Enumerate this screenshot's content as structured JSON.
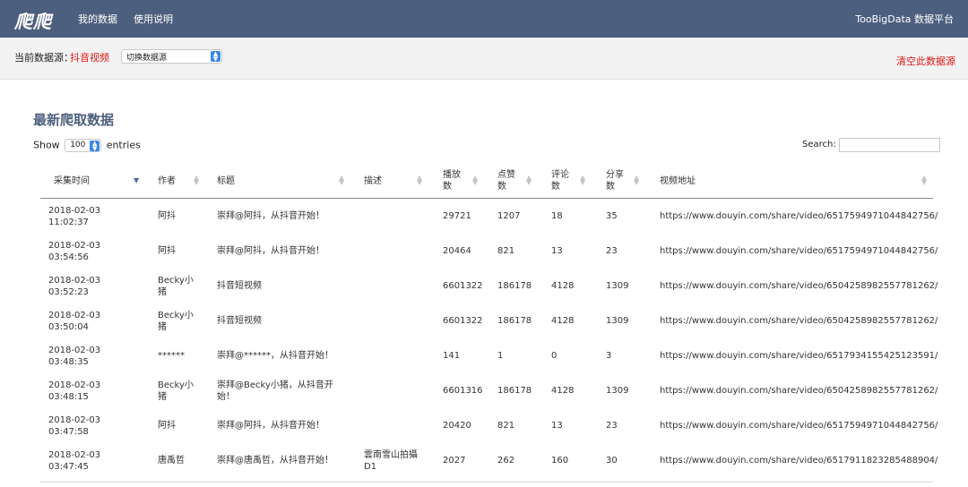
{
  "nav": {
    "logo": "爬爬",
    "links": [
      "我的数据",
      "使用说明"
    ],
    "brand": "TooBigData 数据平台"
  },
  "source": {
    "label": "当前数据源：",
    "value": "抖音视频",
    "select_label": "切换数据源",
    "clear_label": "清空此数据源"
  },
  "section_title": "最新爬取数据",
  "controls": {
    "show": "Show",
    "length": "100",
    "entries": "entries",
    "search": "Search:"
  },
  "table": {
    "headers": [
      "采集时间",
      "作者",
      "标题",
      "描述",
      "播放\n数",
      "点赞\n数",
      "评论\n数",
      "分享\n数",
      "视频地址"
    ],
    "rows": [
      [
        "2018-02-03\n11:02:37",
        "阿抖",
        "崇拜@阿抖，从抖音开始！",
        "",
        "29721",
        "1207",
        "18",
        "35",
        "https://www.douyin.com/share/video/6517594971044842756/"
      ],
      [
        "2018-02-03\n03:54:56",
        "阿抖",
        "崇拜@阿抖，从抖音开始！",
        "",
        "20464",
        "821",
        "13",
        "23",
        "https://www.douyin.com/share/video/6517594971044842756/"
      ],
      [
        "2018-02-03\n03:52:23",
        "Becky小\n猪",
        "抖音短视频",
        "",
        "6601322",
        "186178",
        "4128",
        "1309",
        "https://www.douyin.com/share/video/6504258982557781262/"
      ],
      [
        "2018-02-03\n03:50:04",
        "Becky小\n猪",
        "抖音短视频",
        "",
        "6601322",
        "186178",
        "4128",
        "1309",
        "https://www.douyin.com/share/video/6504258982557781262/"
      ],
      [
        "2018-02-03\n03:48:35",
        "******",
        "崇拜@******，从抖音开始！",
        "",
        "141",
        "1",
        "0",
        "3",
        "https://www.douyin.com/share/video/6517934155425123591/"
      ],
      [
        "2018-02-03\n03:48:15",
        "Becky小\n猪",
        "崇拜@Becky小猪，从抖音开\n始！",
        "",
        "6601316",
        "186178",
        "4128",
        "1309",
        "https://www.douyin.com/share/video/6504258982557781262/"
      ],
      [
        "2018-02-03\n03:47:58",
        "阿抖",
        "崇拜@阿抖，从抖音开始！",
        "",
        "20420",
        "821",
        "13",
        "23",
        "https://www.douyin.com/share/video/6517594971044842756/"
      ],
      [
        "2018-02-03\n03:47:45",
        "唐禹哲",
        "崇拜@唐禹哲，从抖音开始！",
        "雲南雪山拍攝\nD1",
        "2027",
        "262",
        "160",
        "30",
        "https://www.douyin.com/share/video/6517911823285488904/"
      ]
    ]
  },
  "icons": {
    "sort_active": "sort-desc-icon",
    "sort_both": "sort-both-icon",
    "select_arrow": "select-arrow-icon"
  }
}
